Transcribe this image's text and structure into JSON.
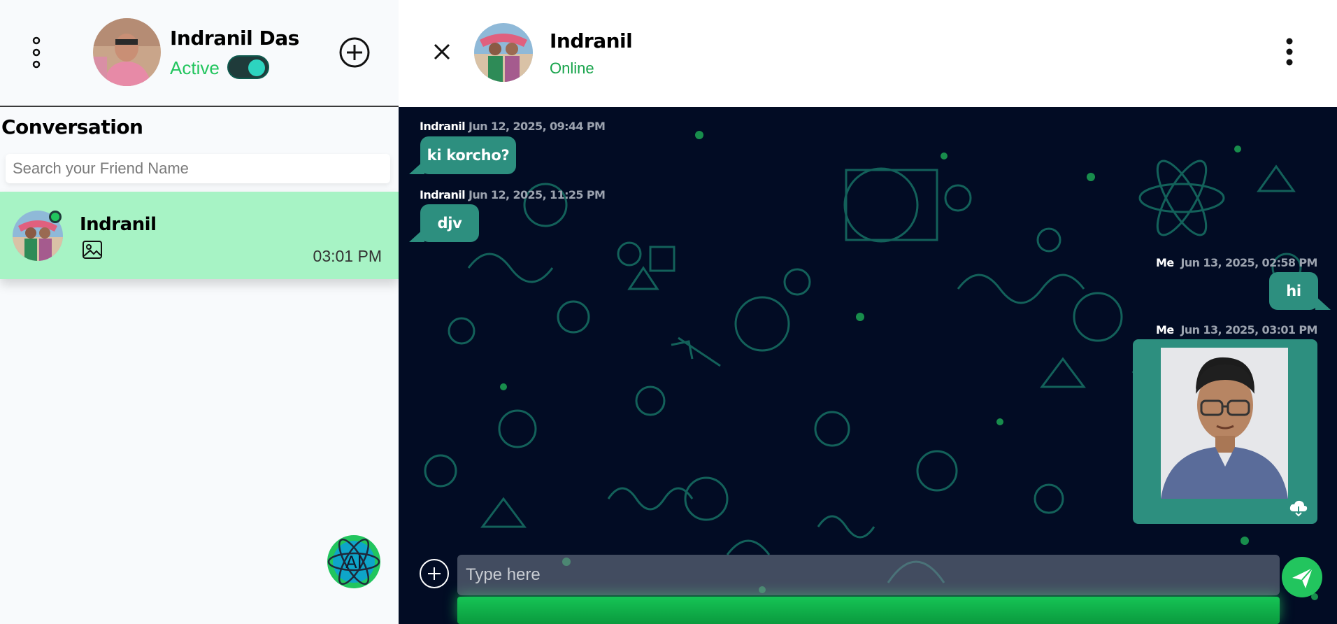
{
  "user": {
    "name": "Indranil Das",
    "status": "Active",
    "active": true
  },
  "sidebar": {
    "title": "Conversation",
    "search_placeholder": "Search your Friend Name",
    "conversations": [
      {
        "name": "Indranil",
        "last_message_type": "image-icon",
        "time": "03:01 PM",
        "online": true
      }
    ]
  },
  "chat": {
    "peer_name": "Indranil",
    "peer_status": "Online",
    "messages": [
      {
        "sender": "Indranil",
        "timestamp": "Jun 12, 2025, 09:44 PM",
        "text": "ki korcho?"
      },
      {
        "sender": "Indranil",
        "timestamp": "Jun 12, 2025, 11:25 PM",
        "text": "djv"
      },
      {
        "sender": "Me",
        "timestamp": "Jun 13, 2025, 02:58 PM",
        "text": "hi"
      },
      {
        "sender": "Me",
        "timestamp": "Jun 13, 2025, 03:01 PM",
        "type": "image"
      }
    ],
    "input_placeholder": "Type here"
  },
  "ai_button": {
    "label": "AI"
  },
  "colors": {
    "accent": "#22c55e",
    "bubble": "#2d8f7f",
    "selected_conversation": "#a7f3c5",
    "chat_background": "#020c24"
  },
  "icons": [
    "menu-dots-icon",
    "add-chat-icon",
    "image-icon",
    "ai-icon",
    "close-icon",
    "kebab-icon",
    "download-icon",
    "attach-plus-icon",
    "send-icon"
  ]
}
